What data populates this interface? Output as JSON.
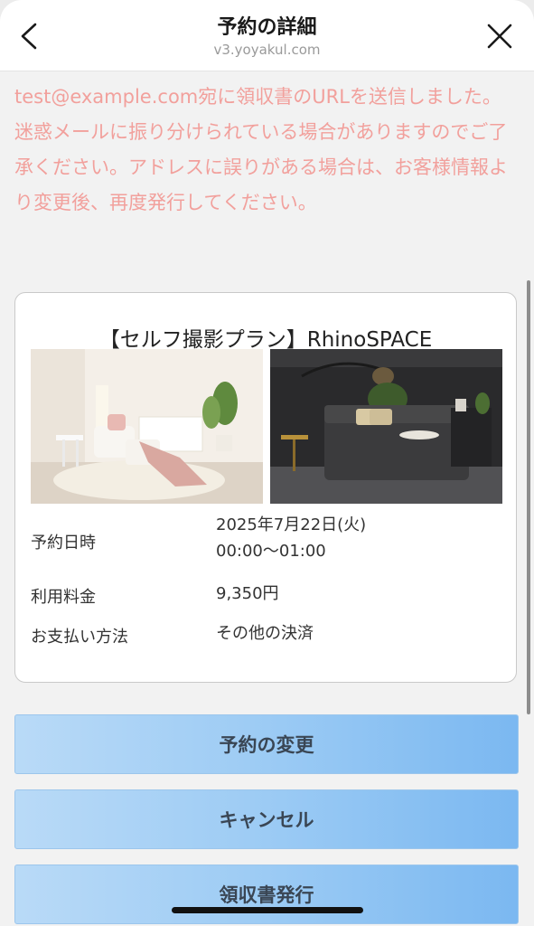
{
  "header": {
    "title": "予約の詳細",
    "url": "v3.yoyakul.com"
  },
  "notice": "test@example.com宛に領収書のURLを送信しました。迷惑メールに振り分けられている場合がありますのでご了承ください。アドレスに誤りがある場合は、お客様情報より変更後、再度発行してください。",
  "reservation": {
    "plan_title": "【セルフ撮影プラン】RhinoSPACE",
    "rows": [
      {
        "label": "予約日時",
        "value_line1": "2025年7月22日(火)",
        "value_line2": "00:00～01:00"
      },
      {
        "label": "利用料金",
        "value_line1": "9,350円"
      },
      {
        "label": "お支払い方法",
        "value_line1": "その他の決済"
      }
    ]
  },
  "buttons": {
    "change": "予約の変更",
    "cancel": "キャンセル",
    "receipt": "領収書発行"
  },
  "colors": {
    "notice_text": "#f2a09c",
    "button_gradient_start": "#b9daf7",
    "button_gradient_end": "#7bb8f1"
  },
  "icons": {
    "back": "chevron-left-icon",
    "close": "close-icon"
  }
}
